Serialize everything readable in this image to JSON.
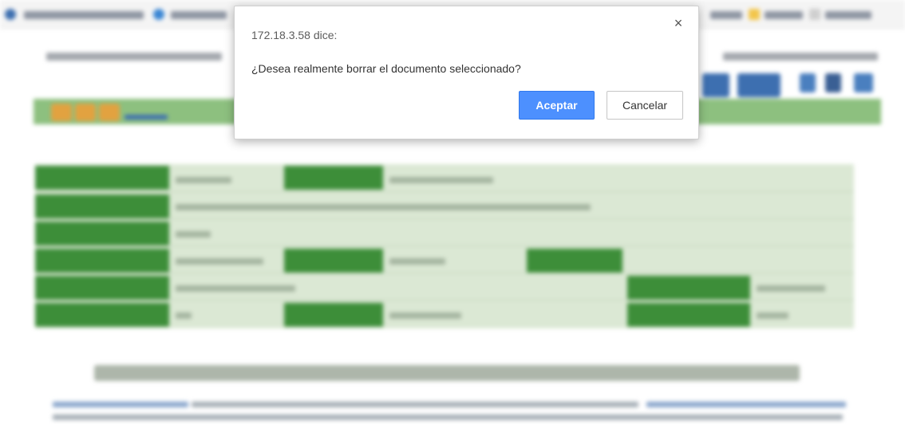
{
  "dialog": {
    "title": "172.18.3.58 dice:",
    "message": "¿Desea realmente borrar el documento seleccionado?",
    "ok_label": "Aceptar",
    "cancel_label": "Cancelar",
    "close_symbol": "×",
    "close_icon": "close-icon"
  },
  "colors": {
    "primary_button": "#4d90fe",
    "dialog_background": "#ffffff",
    "page_green_dark": "#3d8e39",
    "page_green_light": "#dbe8d4"
  }
}
